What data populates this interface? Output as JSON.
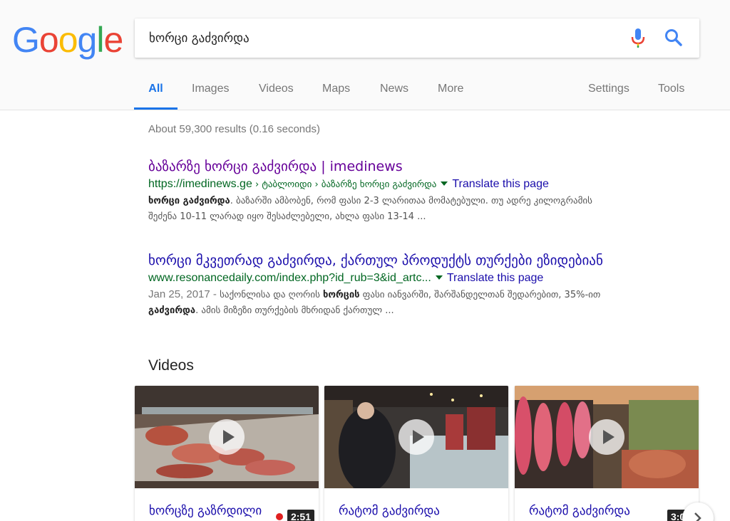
{
  "logo": {
    "letters": [
      "G",
      "o",
      "o",
      "g",
      "l",
      "e"
    ],
    "colors": [
      "#4285F4",
      "#EA4335",
      "#FBBC05",
      "#4285F4",
      "#34A853",
      "#EA4335"
    ]
  },
  "search": {
    "query": "ხორცი გაძვირდა"
  },
  "tabs": [
    {
      "label": "All",
      "active": true
    },
    {
      "label": "Images"
    },
    {
      "label": "Videos"
    },
    {
      "label": "Maps"
    },
    {
      "label": "News"
    },
    {
      "label": "More"
    },
    {
      "label": "Settings"
    },
    {
      "label": "Tools"
    }
  ],
  "stats": "About 59,300 results (0.16 seconds)",
  "results": [
    {
      "title": "ბაზარზე ხორცი გაძვირდა | imedinews",
      "url_main": "https://imedinews.ge",
      "url_crumbs": " › ტაბლოიდი › ბაზარზე ხორცი გაძვირდა",
      "translate": "Translate this page",
      "snippet_bold_1": "ხორცი გაძვირდა",
      "snippet_line1": ". ბაზარში ამბობენ, რომ ფასი 2-3 ლარითაა მომატებული. თუ ადრე კილოგრამის",
      "snippet_line2": "შეძენა 10-11 ლარად იყო შესაძლებელი, ახლა ფასი 13-14 ..."
    },
    {
      "title": "ხორცი მკვეთრად გაძვირდა, ქართულ პროდუქტს თურქები ეზიდებიან",
      "url_main": "www.resonancedaily.com/index.php?id_rub=3&id_artc...",
      "translate": "Translate this page",
      "date": "Jan 25, 2017 - ",
      "snippet_pre": "საქონლისა და ღორის ",
      "snippet_bold_1": "ხორცის",
      "snippet_post": " ფასი იანვარში, შარშანდელთან შედარებით, 35%-ით",
      "snippet_bold_2": "გაძვირდა",
      "snippet_line2": ". ამის მიზეზი თურქების მხრიდან ქართულ ..."
    }
  ],
  "videos": {
    "heading": "Videos",
    "items": [
      {
        "title": "ხორცზე გაზრდილი",
        "duration": "2:51"
      },
      {
        "title": "რატომ გაძვირდა",
        "duration": ""
      },
      {
        "title": "რატომ გაძვირდა",
        "duration": "3:04"
      }
    ]
  },
  "icons": {
    "mic": "microphone-icon",
    "search": "search-icon",
    "play": "play-icon",
    "next": "chevron-right-icon"
  }
}
